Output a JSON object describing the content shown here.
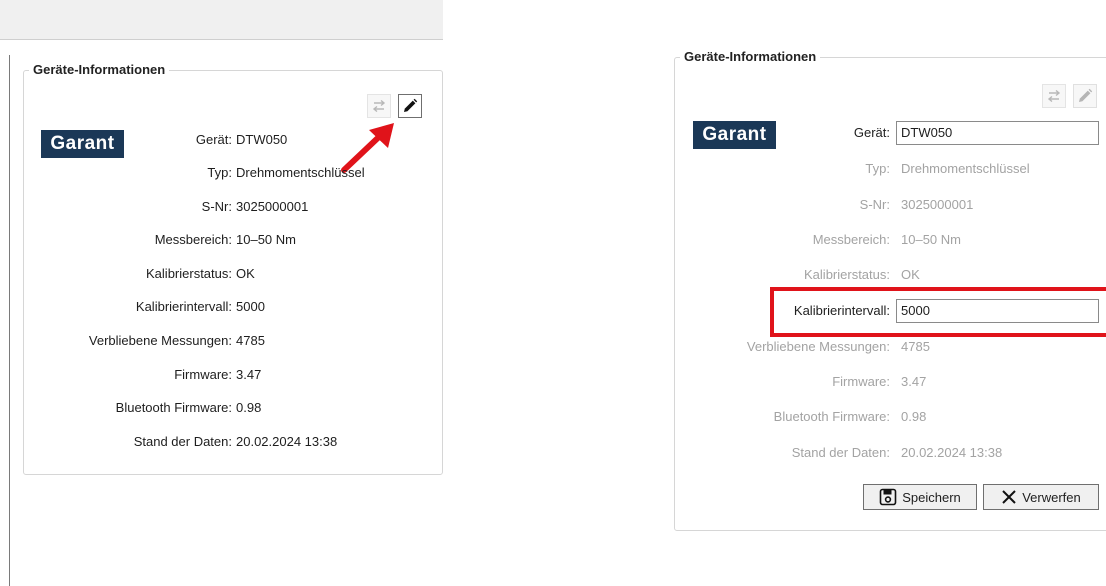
{
  "left_panel": {
    "legend": "Geräte-Informationen",
    "logo": "Garant",
    "fields": [
      {
        "label": "Gerät:",
        "value": "DTW050"
      },
      {
        "label": "Typ:",
        "value": "Drehmomentschlüssel"
      },
      {
        "label": "S-Nr:",
        "value": "3025000001"
      },
      {
        "label": "Messbereich:",
        "value": "10–50 Nm"
      },
      {
        "label": "Kalibrierstatus:",
        "value": "OK"
      },
      {
        "label": "Kalibrierintervall:",
        "value": "5000"
      },
      {
        "label": "Verbliebene Messungen:",
        "value": "4785"
      },
      {
        "label": "Firmware:",
        "value": "3.47"
      },
      {
        "label": "Bluetooth Firmware:",
        "value": "0.98"
      },
      {
        "label": "Stand der Daten:",
        "value": "20.02.2024 13:38"
      }
    ]
  },
  "right_panel": {
    "legend": "Geräte-Informationen",
    "logo": "Garant",
    "fields": [
      {
        "label": "Gerät:",
        "value": "DTW050"
      },
      {
        "label": "Typ:",
        "value": "Drehmomentschlüssel"
      },
      {
        "label": "S-Nr:",
        "value": "3025000001"
      },
      {
        "label": "Messbereich:",
        "value": "10–50 Nm"
      },
      {
        "label": "Kalibrierstatus:",
        "value": "OK"
      },
      {
        "label": "Kalibrierintervall:",
        "value": "5000"
      },
      {
        "label": "Verbliebene Messungen:",
        "value": "4785"
      },
      {
        "label": "Firmware:",
        "value": "3.47"
      },
      {
        "label": "Bluetooth Firmware:",
        "value": "0.98"
      },
      {
        "label": "Stand der Daten:",
        "value": "20.02.2024 13:38"
      }
    ],
    "save_label": "Speichern",
    "discard_label": "Verwerfen"
  },
  "icons": {
    "swap": "swap-arrows-icon",
    "edit": "pencil-icon",
    "save": "floppy-disk-icon",
    "discard": "x-icon",
    "annotation_arrow": "red-arrow"
  },
  "colors": {
    "logo_bg": "#1b3857",
    "annotation_red": "#e0131a",
    "dim_text": "#a3a3a3"
  }
}
